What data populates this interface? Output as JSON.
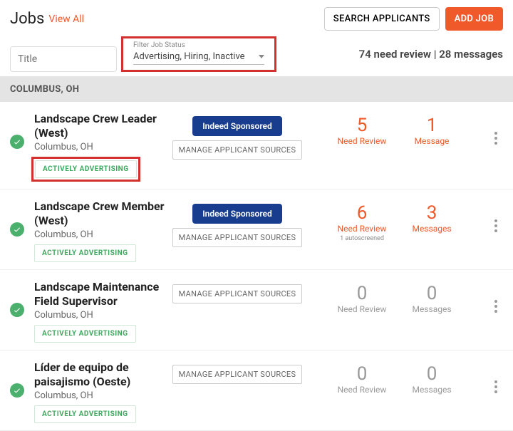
{
  "header": {
    "title": "Jobs",
    "view_all": "View All",
    "search_btn": "SEARCH APPLICANTS",
    "add_btn": "ADD JOB"
  },
  "filters": {
    "title_placeholder": "Title",
    "status_label": "Filter Job Status",
    "status_value": "Advertising, Hiring, Inactive",
    "summary": "74 need review | 28 messages"
  },
  "group_header": "COLUMBUS, OH",
  "badge_label": "ACTIVELY ADVERTISING",
  "sponsored_label": "Indeed Sponsored",
  "manage_label": "MANAGE APPLICANT SOURCES",
  "autoscreened_label": "1 autoscreened",
  "stat_labels": {
    "review": "Need Review",
    "message_s": "Message",
    "messages_p": "Messages"
  },
  "jobs": [
    {
      "title": "Landscape Crew Leader (West)",
      "location": "Columbus, OH",
      "sponsored": true,
      "review": 5,
      "messages": 1,
      "msg_label": "Message",
      "hl_badge": true,
      "auto": false,
      "active": true
    },
    {
      "title": "Landscape Crew Member (West)",
      "location": "Columbus, OH",
      "sponsored": true,
      "review": 6,
      "messages": 3,
      "msg_label": "Messages",
      "hl_badge": false,
      "auto": true,
      "active": true
    },
    {
      "title": "Landscape Maintenance Field Supervisor",
      "location": "Columbus, OH",
      "sponsored": false,
      "review": 0,
      "messages": 0,
      "msg_label": "Messages",
      "hl_badge": false,
      "auto": false,
      "active": false
    },
    {
      "title": "Líder de equipo de paisajismo (Oeste)",
      "location": "Columbus, OH",
      "sponsored": false,
      "review": 0,
      "messages": 0,
      "msg_label": "Messages",
      "hl_badge": false,
      "auto": false,
      "active": false
    }
  ]
}
